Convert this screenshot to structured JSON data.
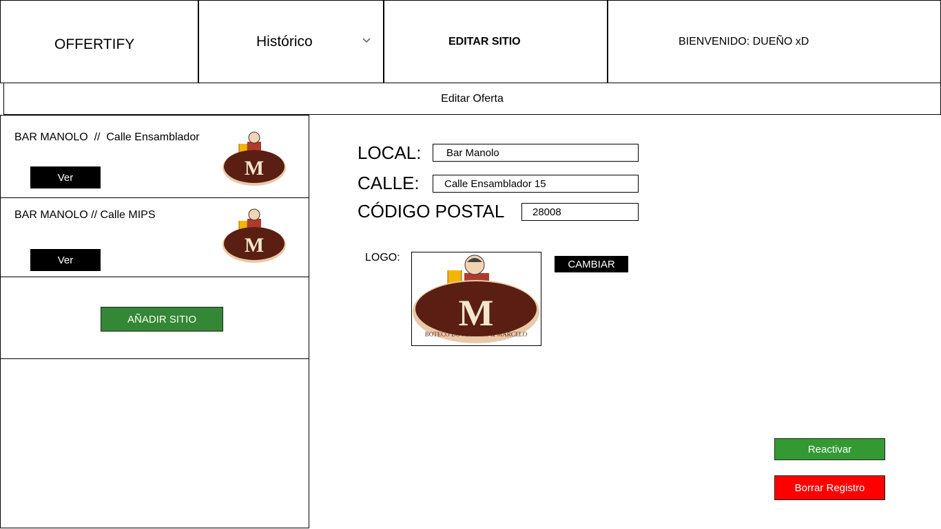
{
  "header": {
    "brand": "OFFERTIFY",
    "history_label": "Histórico",
    "edit_site_label": "EDITAR SITIO",
    "welcome_label": "BIENVENIDO: DUEÑO xD"
  },
  "subheader": {
    "edit_offer_label": "Editar Oferta"
  },
  "sidebar": {
    "sites": [
      {
        "title": "BAR MANOLO  //  Calle Ensamblador",
        "view_label": "Ver",
        "logo_icon": "bar-manolo-logo"
      },
      {
        "title": "BAR MANOLO // Calle MIPS",
        "view_label": "Ver",
        "logo_icon": "bar-manolo-logo"
      }
    ],
    "add_site_label": "AÑADIR SITIO"
  },
  "form": {
    "local_label": "LOCAL:",
    "local_value": "Bar Manolo",
    "street_label": "CALLE:",
    "street_value": "Calle Ensamblador 15",
    "postal_label": "CÓDIGO POSTAL",
    "postal_value": "28008",
    "logo_label": "LOGO:",
    "change_label": "CAMBIAR",
    "logo_text": "BOTECO DO MANOLO & MARCELO"
  },
  "actions": {
    "reactivate_label": "Reactivar",
    "delete_label": "Borrar Registro"
  },
  "colors": {
    "green": "#338735",
    "green_light": "#339933",
    "red": "#ff0000",
    "logo_brown": "#5a1e12"
  }
}
